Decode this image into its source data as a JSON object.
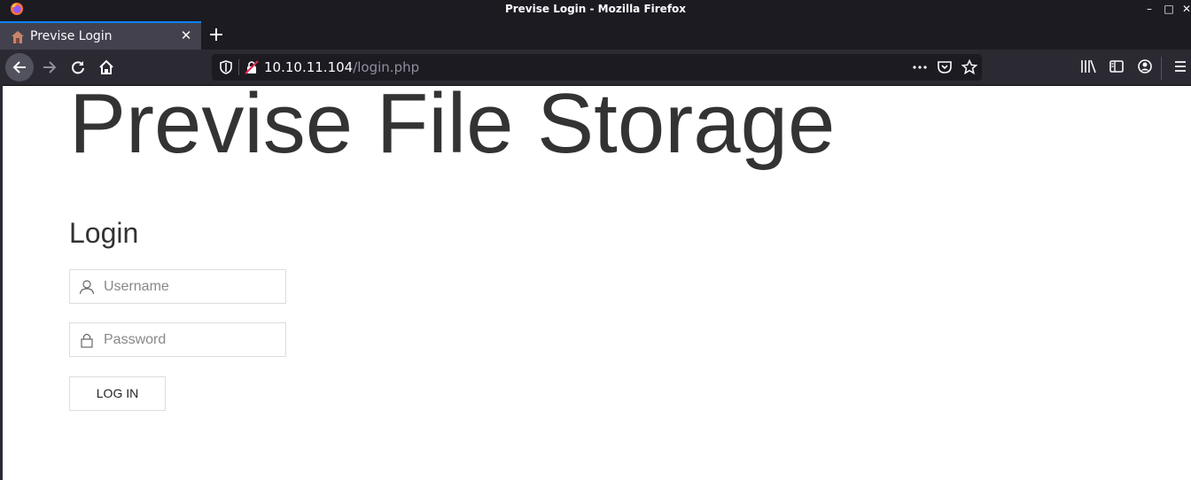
{
  "window": {
    "title": "Previse Login - Mozilla Firefox",
    "controls": [
      "minimize",
      "maximize",
      "close"
    ]
  },
  "tabs": [
    {
      "label": "Previse Login",
      "icon": "site-favicon",
      "active": true
    }
  ],
  "toolbar": {
    "url_host": "10.10.11.104",
    "url_path": "/login.php",
    "icons": [
      "back-icon",
      "forward-icon",
      "reload-icon",
      "home-icon",
      "shield-icon",
      "insecure-lock-icon",
      "more-icon",
      "pocket-icon",
      "bookmark-star-icon",
      "library-icon",
      "sidebar-icon",
      "account-icon",
      "menu-icon"
    ]
  },
  "page": {
    "brand": "Previse File Storage",
    "heading": "Login",
    "username_placeholder": "Username",
    "password_placeholder": "Password",
    "login_button": "LOG IN"
  },
  "colors": {
    "accent": "#0a84ff",
    "toolbar_bg": "#2b2a33",
    "titlebar_bg": "#1c1b22",
    "text": "#333333"
  }
}
